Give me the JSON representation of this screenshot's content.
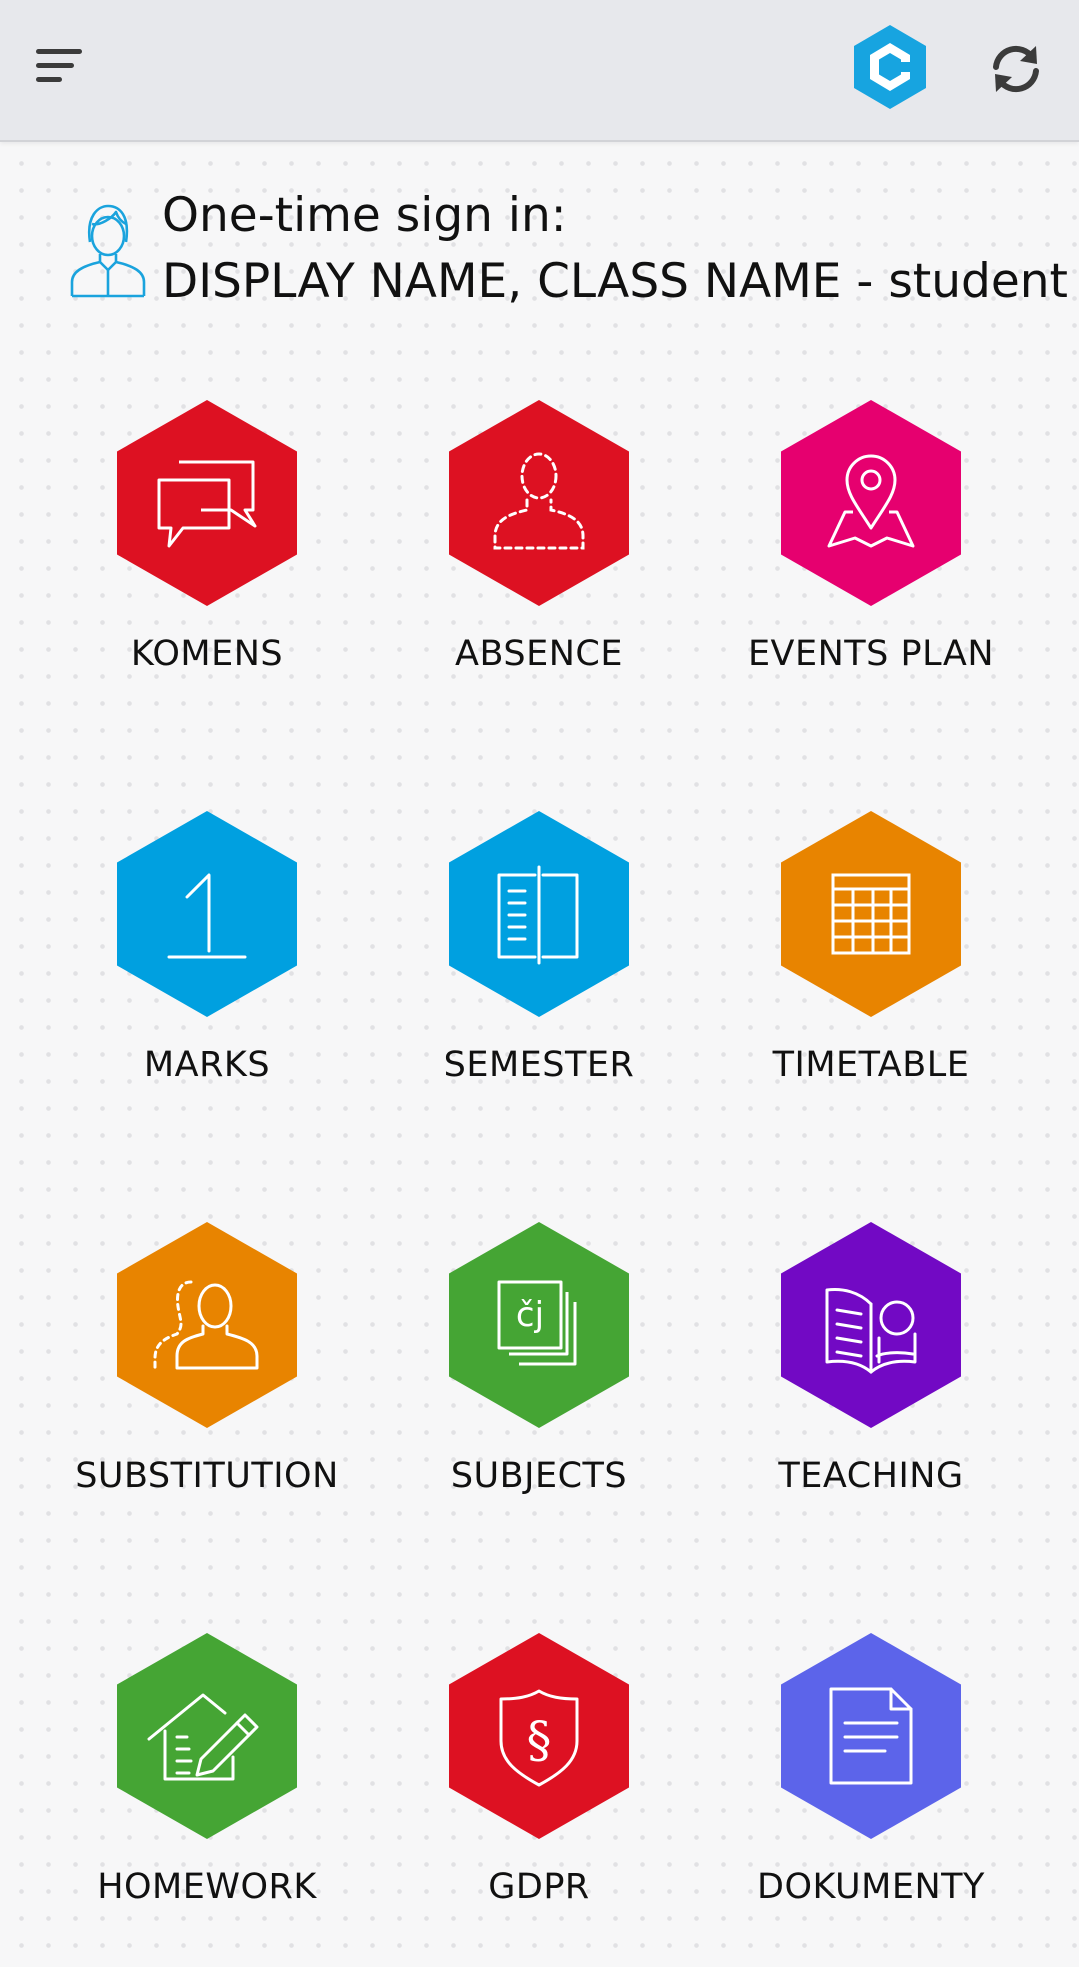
{
  "header": {
    "menu_icon": "hamburger-menu-icon",
    "logo_icon": "bakalari-logo",
    "refresh_icon": "refresh-icon",
    "logo_color": "#17a4e0"
  },
  "signin": {
    "avatar_icon": "student-avatar-icon",
    "line1": "One-time sign in:",
    "line2": "DISPLAY NAME, CLASS NAME - student"
  },
  "tiles": [
    {
      "label": "KOMENS",
      "icon": "chat-bubbles-icon",
      "color": "#dd1122"
    },
    {
      "label": "ABSENCE",
      "icon": "absent-person-icon",
      "color": "#dd1122"
    },
    {
      "label": "EVENTS PLAN",
      "icon": "map-pin-icon",
      "color": "#e6006f"
    },
    {
      "label": "MARKS",
      "icon": "mark-one-icon",
      "color": "#00a0e0"
    },
    {
      "label": "SEMESTER",
      "icon": "report-book-icon",
      "color": "#00a0e0"
    },
    {
      "label": "TIMETABLE",
      "icon": "timetable-grid-icon",
      "color": "#e88400"
    },
    {
      "label": "SUBSTITUTION",
      "icon": "substitute-person-icon",
      "color": "#e88400"
    },
    {
      "label": "SUBJECTS",
      "icon": "subjects-cards-icon",
      "color": "#45a534",
      "icon_text": "čj"
    },
    {
      "label": "TEACHING",
      "icon": "open-book-icon",
      "color": "#7209c4"
    },
    {
      "label": "HOMEWORK",
      "icon": "house-pencil-icon",
      "color": "#45a534"
    },
    {
      "label": "GDPR",
      "icon": "shield-paragraph-icon",
      "color": "#dd1122",
      "icon_text": "§"
    },
    {
      "label": "DOKUMENTY",
      "icon": "document-icon",
      "color": "#5c64ea"
    }
  ]
}
